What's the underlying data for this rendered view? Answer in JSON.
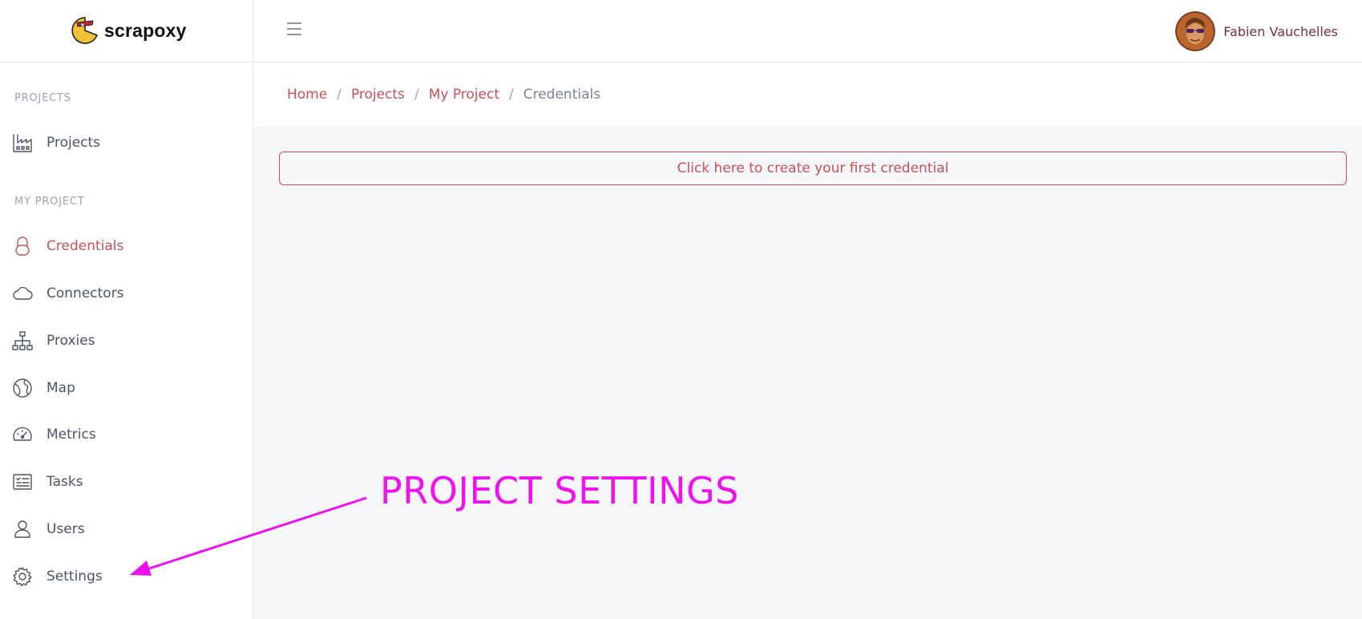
{
  "app": {
    "brand": "scrapoxy"
  },
  "header": {
    "user_name": "Fabien Vauchelles"
  },
  "sidebar": {
    "sections": [
      {
        "title": "PROJECTS",
        "items": [
          {
            "label": "Projects",
            "icon": "factory-icon",
            "active": false
          }
        ]
      },
      {
        "title": "MY PROJECT",
        "items": [
          {
            "label": "Credentials",
            "icon": "lock-icon",
            "active": true
          },
          {
            "label": "Connectors",
            "icon": "cloud-icon",
            "active": false
          },
          {
            "label": "Proxies",
            "icon": "sitemap-icon",
            "active": false
          },
          {
            "label": "Map",
            "icon": "globe-icon",
            "active": false
          },
          {
            "label": "Metrics",
            "icon": "speedometer-icon",
            "active": false
          },
          {
            "label": "Tasks",
            "icon": "task-list-icon",
            "active": false
          },
          {
            "label": "Users",
            "icon": "user-icon",
            "active": false
          },
          {
            "label": "Settings",
            "icon": "gear-icon",
            "active": false
          }
        ]
      }
    ]
  },
  "breadcrumb": {
    "items": [
      "Home",
      "Projects",
      "My Project",
      "Credentials"
    ],
    "separator": "/"
  },
  "main": {
    "create_button_label": "Click here to create your first credential"
  },
  "annotation": {
    "text": "PROJECT SETTINGS",
    "color": "#ee12ee"
  },
  "colors": {
    "accent": "#c74f57",
    "user_name": "#7a2c44",
    "muted": "#9aa3b2",
    "background": "#f5f6f8"
  }
}
